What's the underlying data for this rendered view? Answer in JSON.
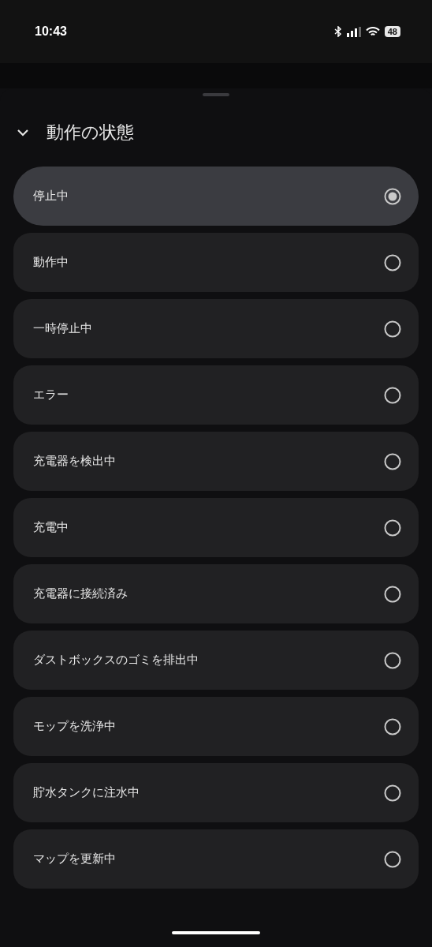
{
  "status_bar": {
    "time": "10:43",
    "battery": "48"
  },
  "sheet": {
    "title": "動作の状態",
    "expanded": true
  },
  "options": [
    {
      "label": "停止中",
      "selected": true
    },
    {
      "label": "動作中",
      "selected": false
    },
    {
      "label": "一時停止中",
      "selected": false
    },
    {
      "label": "エラー",
      "selected": false
    },
    {
      "label": "充電器を検出中",
      "selected": false
    },
    {
      "label": "充電中",
      "selected": false
    },
    {
      "label": "充電器に接続済み",
      "selected": false
    },
    {
      "label": "ダストボックスのゴミを排出中",
      "selected": false
    },
    {
      "label": "モップを洗浄中",
      "selected": false
    },
    {
      "label": "貯水タンクに注水中",
      "selected": false
    },
    {
      "label": "マップを更新中",
      "selected": false
    }
  ]
}
